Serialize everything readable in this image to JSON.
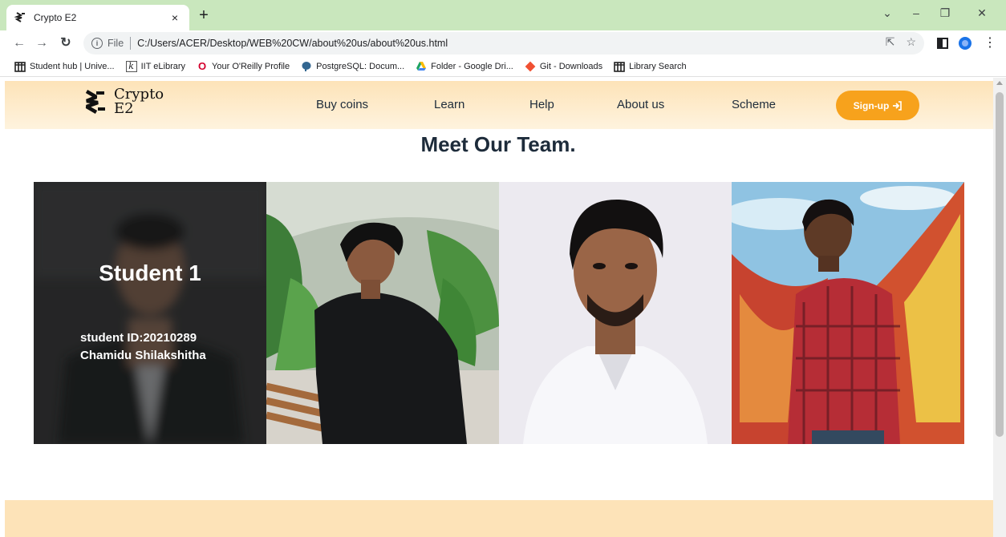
{
  "browser": {
    "tab_title": "Crypto E2",
    "tab_close": "×",
    "new_tab": "+",
    "omnibox_scheme": "File",
    "url": "C:/Users/ACER/Desktop/WEB%20CW/about%20us/about%20us.html",
    "bookmarks": [
      {
        "label": "Student hub | Unive...",
        "icon": "building-icon"
      },
      {
        "label": "IIT eLibrary",
        "icon": "k-icon"
      },
      {
        "label": "Your O'Reilly Profile",
        "icon": "oreilly-icon"
      },
      {
        "label": "PostgreSQL: Docum...",
        "icon": "elephant-icon"
      },
      {
        "label": "Folder - Google Dri...",
        "icon": "drive-icon"
      },
      {
        "label": "Git - Downloads",
        "icon": "git-icon"
      },
      {
        "label": "Library Search",
        "icon": "building-icon"
      }
    ]
  },
  "site": {
    "logo_line1": "Crypto",
    "logo_line2": "E2",
    "nav": {
      "buy_coins": "Buy coins",
      "learn": "Learn",
      "help": "Help",
      "about_us": "About us",
      "scheme": "Scheme"
    },
    "signup_label": "Sign-up",
    "team_title": "Meet Our Team.",
    "cards": [
      {
        "name": "Student 1",
        "id_line": "student ID:20210289",
        "person": "Chamidu Shilakshitha"
      }
    ]
  },
  "colors": {
    "tab_bar": "#c9e7bd",
    "header": "#fde3b8",
    "accent": "#f7a21c",
    "text_dark": "#1d2b3a"
  }
}
